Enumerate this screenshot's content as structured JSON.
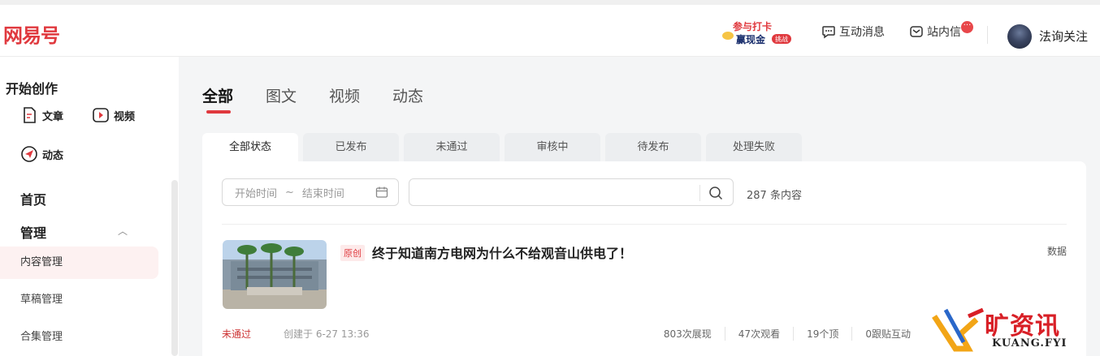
{
  "header": {
    "logo": "网易号",
    "banner_line1": "参与打卡",
    "banner_line2": "赢现金",
    "banner_tag": "挑战",
    "interact_label": "互动消息",
    "inbox_label": "站内信",
    "inbox_badge": "···",
    "username": "法询关注"
  },
  "sidebar": {
    "create_title": "开始创作",
    "create_article": "文章",
    "create_video": "视频",
    "create_dynamic": "动态",
    "home": "首页",
    "manage": "管理",
    "items": [
      {
        "label": "内容管理"
      },
      {
        "label": "草稿管理"
      },
      {
        "label": "合集管理"
      }
    ]
  },
  "main": {
    "tabs": [
      "全部",
      "图文",
      "视频",
      "动态"
    ],
    "status_tabs": [
      "全部状态",
      "已发布",
      "未通过",
      "审核中",
      "待发布",
      "处理失败"
    ],
    "start_placeholder": "开始时间",
    "range_sep": "~",
    "end_placeholder": "结束时间",
    "count": "287 条内容"
  },
  "article": {
    "badge": "原创",
    "title": "终于知道南方电网为什么不给观音山供电了！",
    "data_link": "数据",
    "status": "未通过",
    "created": "创建于 6-27 13:36",
    "impressions": "803次展现",
    "views": "47次观看",
    "likes": "19个顶",
    "comments": "0跟贴互动"
  },
  "watermark": {
    "brand": "旷资讯",
    "domain": "KUANG.FYI"
  }
}
